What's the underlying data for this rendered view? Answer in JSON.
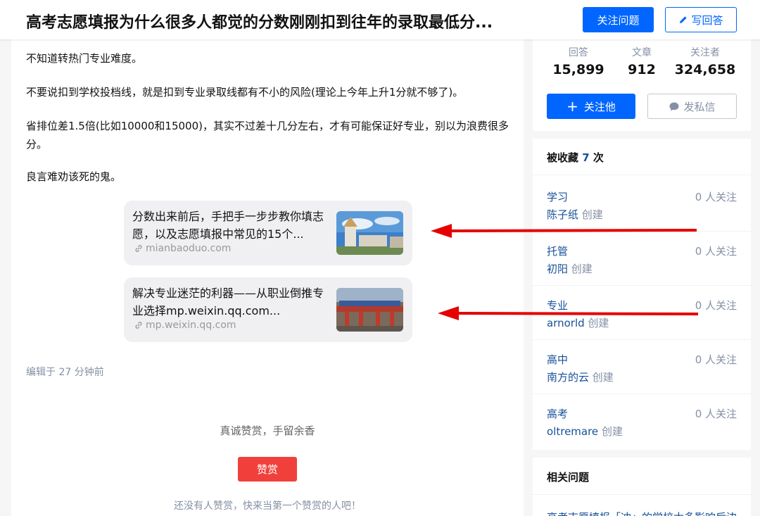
{
  "header": {
    "question_title": "高考志愿填报为什么很多人都觉的分数刚刚扣到往年的录取最低分...",
    "follow_question_label": "关注问题",
    "write_answer_label": "写回答"
  },
  "answer": {
    "paragraphs": [
      "不知道转热门专业难度。",
      "不要说扣到学校投档线，就是扣到专业录取线都有不小的风险(理论上今年上升1分就不够了)。",
      "省排位差1.5倍(比如10000和15000)，其实不过差十几分左右，才有可能保证好专业，别以为浪费很多分。",
      "良言难劝该死的鬼。"
    ],
    "link_cards": [
      {
        "title": "分数出来前后，手把手一步步教你填志愿，以及志愿填报中常见的15个...",
        "url": "mianbaoduo.com"
      },
      {
        "title": "解决专业迷茫的利器——从职业倒推专业选择mp.weixin.qq.com...",
        "url": "mp.weixin.qq.com"
      }
    ],
    "edited": "编辑于 27 分钟前",
    "reward_prompt": "真诚赞赏，手留余香",
    "reward_button": "赞赏",
    "reward_empty": "还没有人赞赏，快来当第一个赞赏的人吧！"
  },
  "author_stats": {
    "items": [
      {
        "label": "回答",
        "value": "15,899"
      },
      {
        "label": "文章",
        "value": "912"
      },
      {
        "label": "关注者",
        "value": "324,658"
      }
    ],
    "follow_label": "关注他",
    "message_label": "发私信"
  },
  "collections": {
    "title_prefix": "被收藏",
    "count": "7",
    "title_suffix": "次",
    "creator_suffix": "创建",
    "items": [
      {
        "name": "学习",
        "creator": "陈子纸",
        "followers": "0 人关注"
      },
      {
        "name": "托管",
        "creator": "初阳",
        "followers": "0 人关注"
      },
      {
        "name": "专业",
        "creator": "arnorld",
        "followers": "0 人关注"
      },
      {
        "name": "高中",
        "creator": "南方的云",
        "followers": "0 人关注"
      },
      {
        "name": "高考",
        "creator": "oltremare",
        "followers": "0 人关注"
      }
    ]
  },
  "related": {
    "title": "相关问题",
    "first_link": "高考志愿填报「冲」的学校太多影响后边"
  },
  "colors": {
    "primary": "#0066ff",
    "link": "#175199",
    "reward": "#f1403c",
    "annotation_arrow": "#e60000"
  }
}
